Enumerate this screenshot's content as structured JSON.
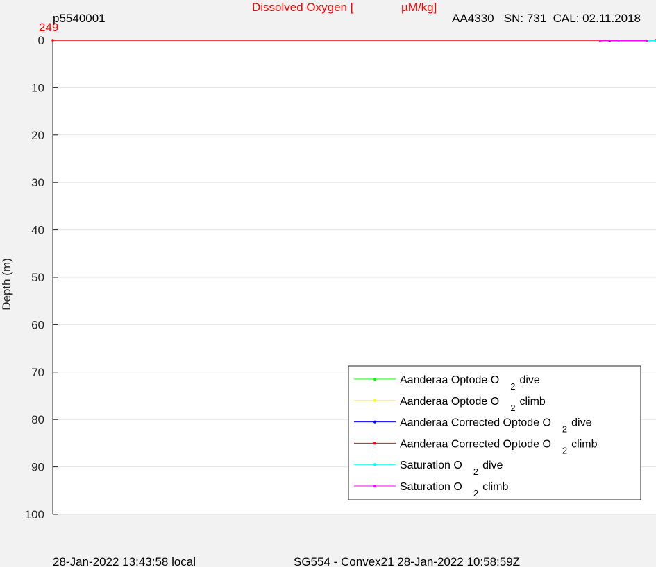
{
  "chart_data": {
    "type": "line",
    "title_red": "Dissolved Oxygen [",
    "title_red_mu": "µM/kg]",
    "title_top_value": "249",
    "top_left_label": "p5540001",
    "top_right_label": "AA4330   SN: 731  CAL: 02.11.2018",
    "ylabel": "Depth (m)",
    "xlabel": "",
    "ylim": [
      0,
      100
    ],
    "y_reversed": true,
    "y_ticks": [
      0,
      10,
      20,
      30,
      40,
      50,
      60,
      70,
      80,
      90,
      100
    ],
    "y_tick_labels": [
      "0",
      "10",
      "20",
      "30",
      "40",
      "50",
      "60",
      "70",
      "80",
      "90",
      "100"
    ],
    "xlim": [
      249,
      262
    ],
    "grid": true,
    "legend_position": "bottom-right",
    "series": [
      {
        "name": "Aanderaa Optode O",
        "subscript": "2",
        "suffix": "dive",
        "color": "#00ff00",
        "points": [
          [
            261.0,
            0.1
          ],
          [
            262.0,
            0.1
          ]
        ]
      },
      {
        "name": "Aanderaa Optode O",
        "subscript": "2",
        "suffix": "climb",
        "color": "#ffff00",
        "points": [
          [
            261.0,
            0.1
          ],
          [
            262.0,
            0.1
          ]
        ]
      },
      {
        "name": "Aanderaa Corrected Optode O",
        "subscript": "2",
        "suffix": "dive",
        "color": "#0000ff",
        "points": [
          [
            261.0,
            0.1
          ],
          [
            262.0,
            0.1
          ]
        ]
      },
      {
        "name": "Aanderaa Corrected Optode O",
        "subscript": "2",
        "suffix": "climb",
        "color": "#ff0000",
        "points": [
          [
            249.0,
            0.0
          ],
          [
            262.0,
            0.0
          ]
        ]
      },
      {
        "name": "Saturation O",
        "subscript": "2",
        "suffix": "dive",
        "color": "#00ffff",
        "points": [
          [
            261.2,
            0.1
          ],
          [
            262.0,
            0.1
          ]
        ]
      },
      {
        "name": "Saturation O",
        "subscript": "2",
        "suffix": "climb",
        "color": "#ff00ff",
        "points": [
          [
            260.8,
            0.1
          ],
          [
            261.8,
            0.1
          ]
        ]
      }
    ]
  },
  "footer": {
    "left": "28-Jan-2022 13:43:58 local",
    "center": "SG554 - Convex21 28-Jan-2022 10:58:59Z"
  }
}
